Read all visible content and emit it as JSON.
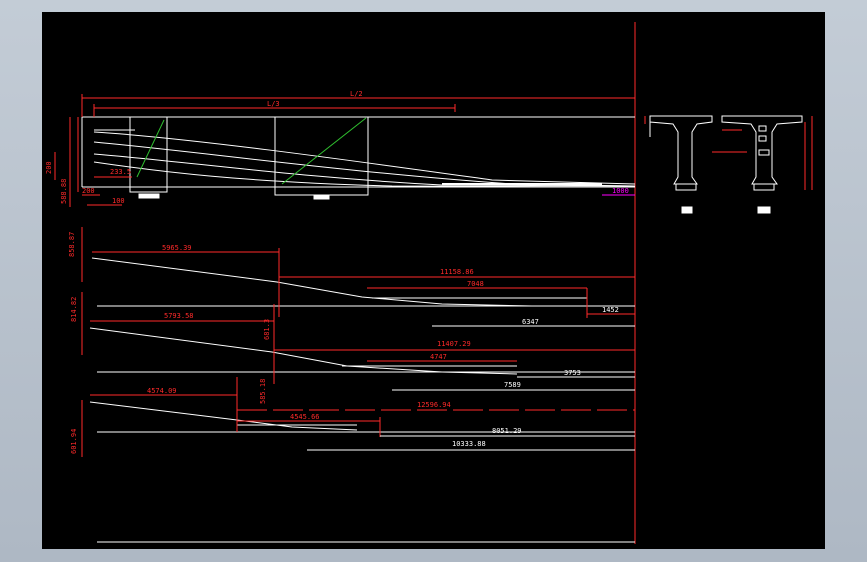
{
  "colors": {
    "background": "#000000",
    "frame": "#bdc6d0",
    "dimension": "#ff2a2a",
    "geometry": "#ffffff",
    "diagonal": "#2fbf2f",
    "highlight": "#ff00ff"
  },
  "top_labels": {
    "half_span": "L/2",
    "third_span": "L/3",
    "dim_200": "200",
    "dim_588": "588.88",
    "dim_233": "233.5",
    "dim_100": "100",
    "dim_200b": "200",
    "dim_1000": "1000"
  },
  "profile_1": {
    "left_height": "858.87",
    "length_left": "5965.39",
    "length_right": "11158.86",
    "inner": "7048",
    "short": "1452",
    "bottom": "6347"
  },
  "profile_2": {
    "left_height": "814.82",
    "length_left": "5793.58",
    "mid_height": "681.3",
    "length_right": "11407.29",
    "inner": "4747",
    "short": "3753",
    "bottom": "7589"
  },
  "profile_3": {
    "left_height": "601.94",
    "mid_height": "585.18",
    "length_left": "4574.09",
    "length_mid": "4545.66",
    "length_right": "12596.94",
    "inner": "8051.29",
    "bottom": "10333.88"
  }
}
